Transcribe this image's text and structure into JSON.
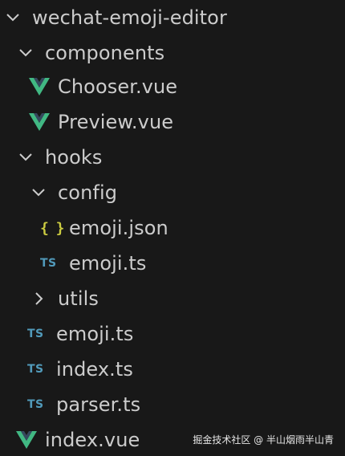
{
  "tree": {
    "root": {
      "label": "wechat-emoji-editor",
      "expanded": true
    },
    "components": {
      "label": "components",
      "expanded": true
    },
    "chooser": {
      "label": "Chooser.vue",
      "icon": "vue-icon"
    },
    "preview": {
      "label": "Preview.vue",
      "icon": "vue-icon"
    },
    "hooks": {
      "label": "hooks",
      "expanded": true
    },
    "config": {
      "label": "config",
      "expanded": true
    },
    "emoji_json": {
      "label": "emoji.json",
      "icon": "json-icon",
      "icon_text": "{ }"
    },
    "config_emoji_ts": {
      "label": "emoji.ts",
      "icon": "ts-icon",
      "icon_text": "TS"
    },
    "utils": {
      "label": "utils",
      "expanded": false
    },
    "hooks_emoji_ts": {
      "label": "emoji.ts",
      "icon": "ts-icon",
      "icon_text": "TS"
    },
    "index_ts": {
      "label": "index.ts",
      "icon": "ts-icon",
      "icon_text": "TS"
    },
    "parser_ts": {
      "label": "parser.ts",
      "icon": "ts-icon",
      "icon_text": "TS"
    },
    "index_vue": {
      "label": "index.vue",
      "icon": "vue-icon"
    }
  },
  "watermark": "掘金技术社区 @ 半山烟雨半山青",
  "colors": {
    "background": "#181818",
    "text": "#cccccc",
    "vue_green": "#41b883",
    "ts_blue": "#519aba",
    "json_yellow": "#cbcb41"
  }
}
